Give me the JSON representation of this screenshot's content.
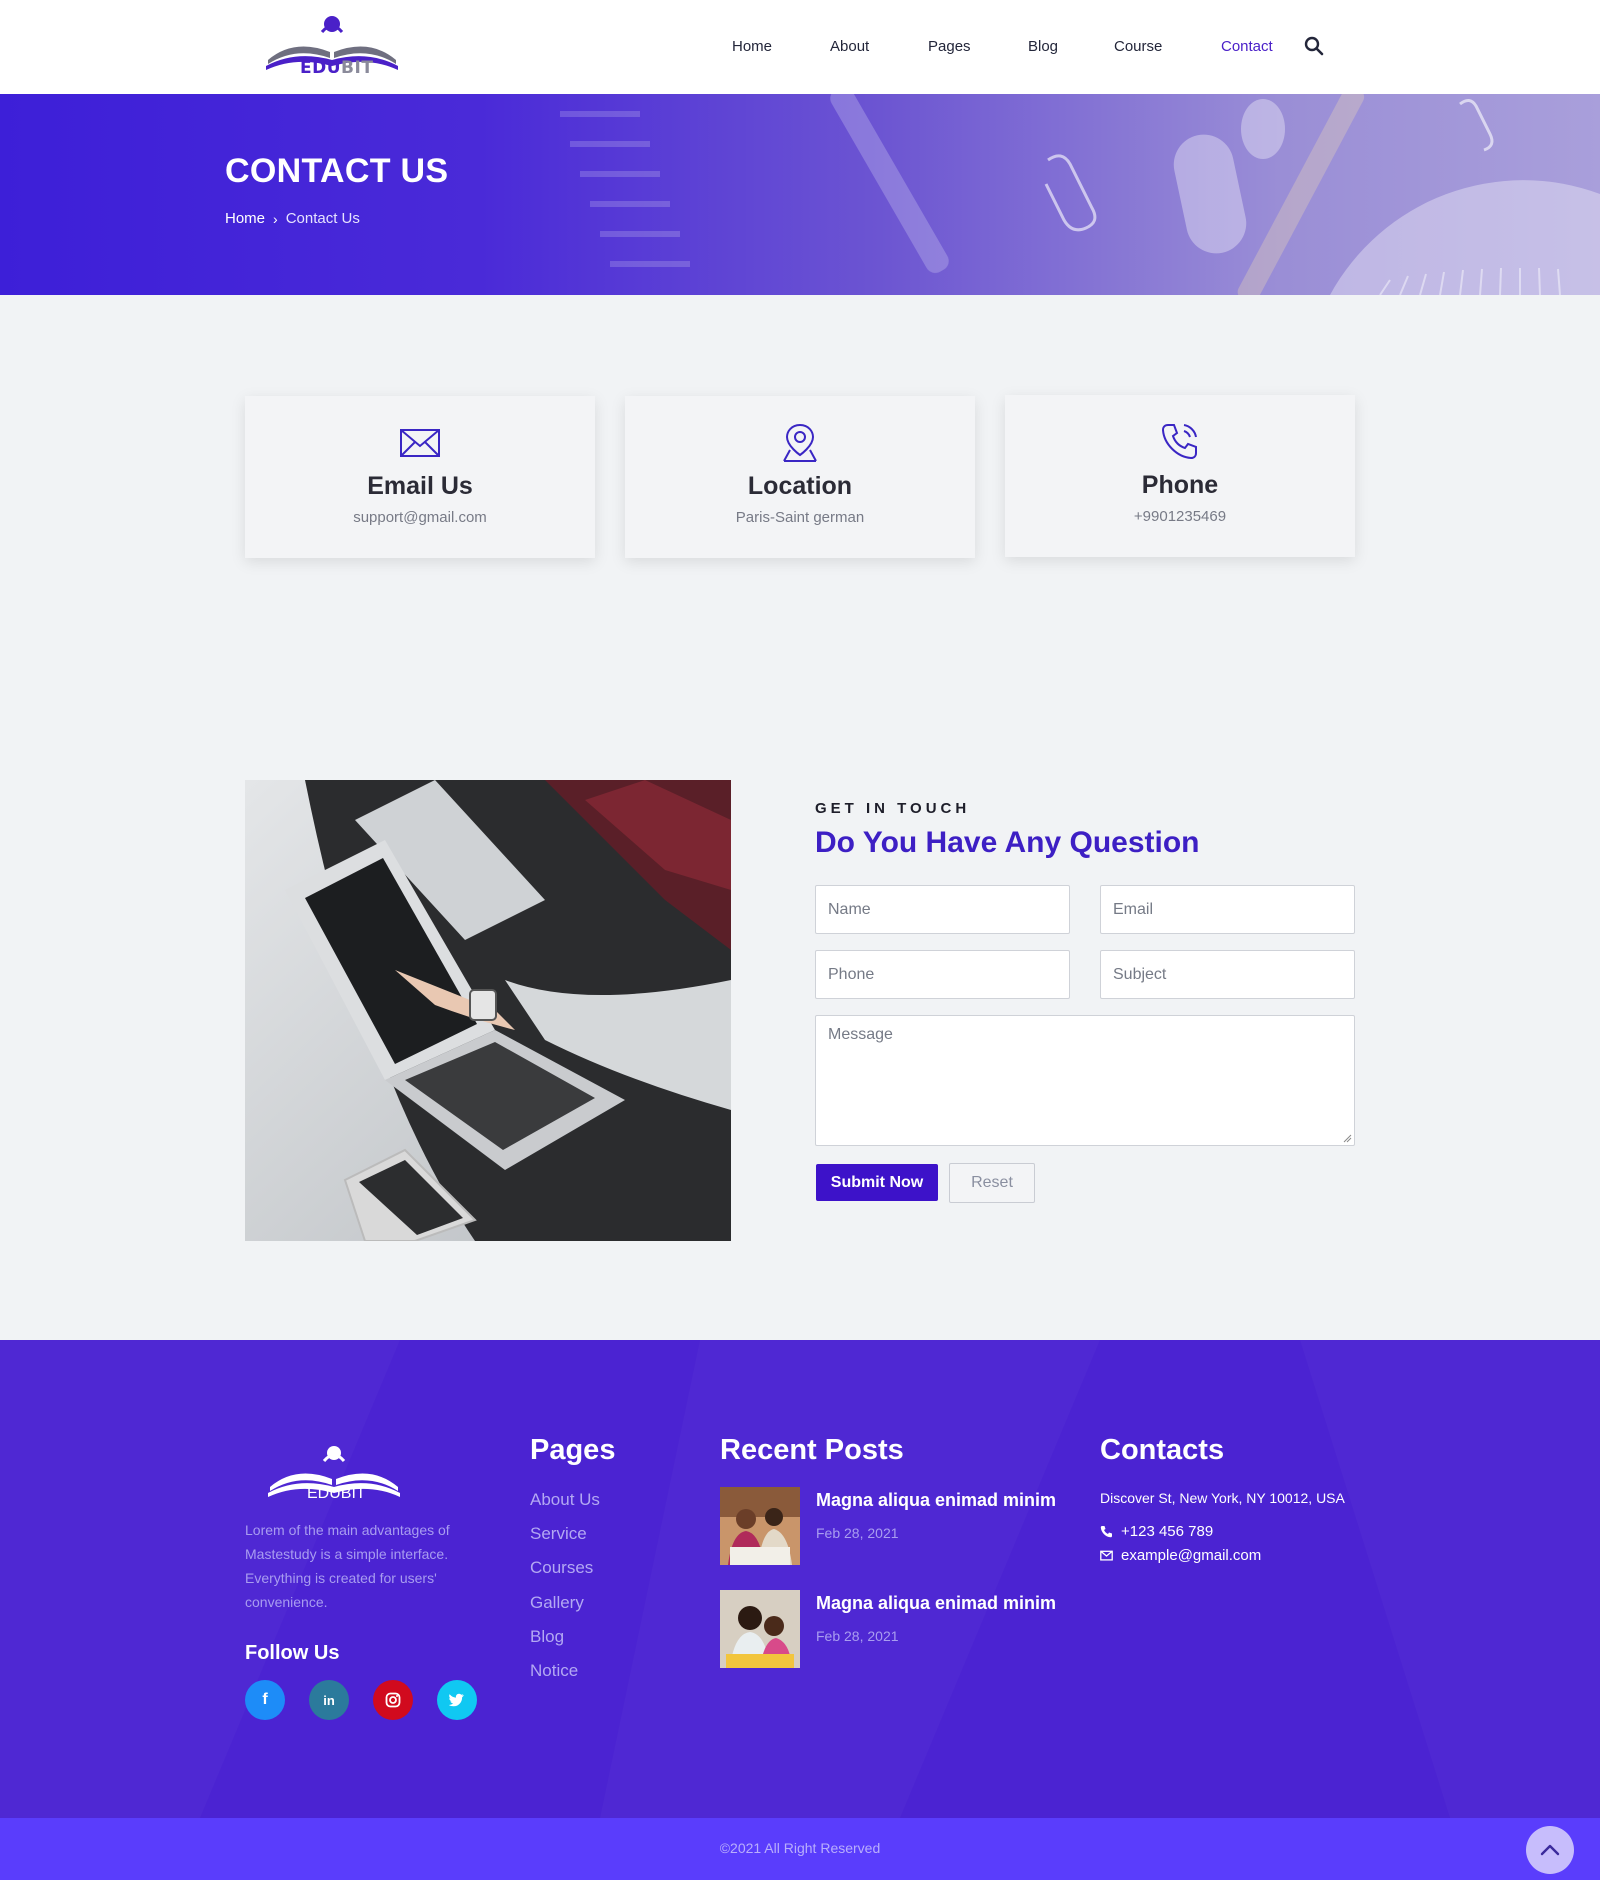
{
  "brand": {
    "part1": "EDU",
    "part2": "BIT",
    "footer_name": "EDUBIT"
  },
  "nav": {
    "items": [
      "Home",
      "About",
      "Pages",
      "Blog",
      "Course",
      "Contact"
    ],
    "active": "Contact"
  },
  "banner": {
    "title": "CONTACT US",
    "breadcrumb_home": "Home",
    "breadcrumb_current": "Contact Us"
  },
  "cards": [
    {
      "icon": "envelope-icon",
      "title": "Email Us",
      "value": "support@gmail.com"
    },
    {
      "icon": "map-pin-icon",
      "title": "Location",
      "value": "Paris-Saint german"
    },
    {
      "icon": "phone-icon",
      "title": "Phone",
      "value": "+9901235469"
    }
  ],
  "contact_form": {
    "eyebrow": "GET IN TOUCH",
    "title": "Do You Have Any Question",
    "name_placeholder": "Name",
    "email_placeholder": "Email",
    "phone_placeholder": "Phone",
    "subject_placeholder": "Subject",
    "message_placeholder": "Message",
    "submit_label": "Submit Now",
    "reset_label": "Reset"
  },
  "footer": {
    "description": "Lorem of the main advantages of Mastestudy is a simple interface. Everything is created for users' convenience.",
    "follow_title": "Follow Us",
    "social": [
      {
        "name": "facebook-icon",
        "glyph": "f",
        "color": "#1d8cf8"
      },
      {
        "name": "linkedin-icon",
        "glyph": "in",
        "color": "#2b7a9c"
      },
      {
        "name": "instagram-icon",
        "glyph": "◎",
        "color": "#d10a1e"
      },
      {
        "name": "twitter-icon",
        "glyph": "🐦",
        "color": "#10c8f2"
      }
    ],
    "pages_title": "Pages",
    "pages": [
      "About Us",
      "Service",
      "Courses",
      "Gallery",
      "Blog",
      "Notice"
    ],
    "recent_title": "Recent Posts",
    "posts": [
      {
        "title": "Magna aliqua enimad minim",
        "date": "Feb 28, 2021"
      },
      {
        "title": "Magna aliqua enimad minim",
        "date": "Feb 28, 2021"
      }
    ],
    "contacts_title": "Contacts",
    "address": "Discover St, New York, NY 10012, USA",
    "phone": "+123 456 789",
    "email": "example@gmail.com",
    "copyright": "©2021 All Right Reserved"
  },
  "colors": {
    "primary": "#3d12c9",
    "footer": "#4b23d2",
    "bottom_bar": "#5a3dfc"
  }
}
